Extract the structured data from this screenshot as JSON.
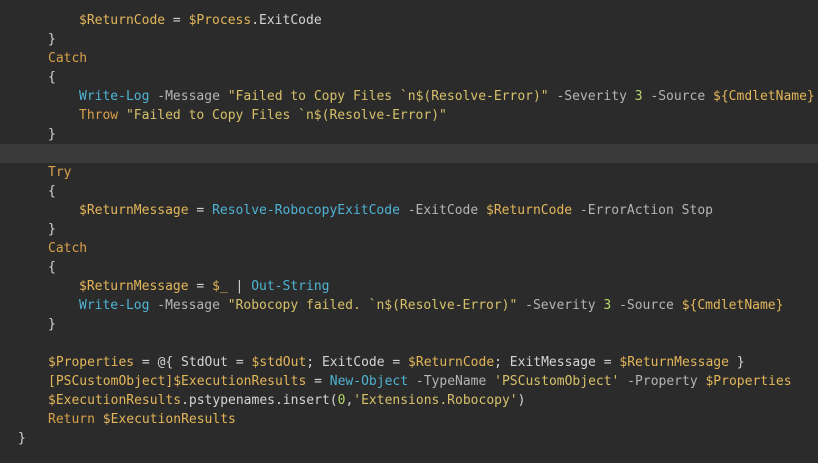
{
  "colors": {
    "background": "#2b2b2b",
    "current_line": "#3a3a3a",
    "default": "#d4d4d4",
    "keyword": "#d8a24a",
    "variable": "#e3b65a",
    "cmdlet": "#4fb3d4",
    "param": "#b4b4b4",
    "string": "#d6c06a",
    "punct": "#d4d4d4",
    "number": "#b7d86b"
  },
  "lines": [
    {
      "indent": 8,
      "tokens": [
        {
          "t": "$ReturnCode",
          "c": "variable"
        },
        {
          "t": " = ",
          "c": "punct"
        },
        {
          "t": "$Process",
          "c": "variable"
        },
        {
          "t": ".ExitCode",
          "c": "default"
        }
      ]
    },
    {
      "indent": 4,
      "tokens": [
        {
          "t": "}",
          "c": "punct"
        }
      ]
    },
    {
      "indent": 4,
      "tokens": [
        {
          "t": "Catch",
          "c": "keyword"
        }
      ]
    },
    {
      "indent": 4,
      "tokens": [
        {
          "t": "{",
          "c": "punct"
        }
      ]
    },
    {
      "indent": 8,
      "tokens": [
        {
          "t": "Write-Log",
          "c": "cmdlet"
        },
        {
          "t": " -Message ",
          "c": "param"
        },
        {
          "t": "\"Failed to Copy Files `n$(Resolve-Error)\"",
          "c": "string"
        },
        {
          "t": " -Severity ",
          "c": "param"
        },
        {
          "t": "3",
          "c": "number"
        },
        {
          "t": " -Source ",
          "c": "param"
        },
        {
          "t": "${CmdletName}",
          "c": "variable"
        }
      ]
    },
    {
      "indent": 8,
      "tokens": [
        {
          "t": "Throw",
          "c": "keyword"
        },
        {
          "t": " ",
          "c": "default"
        },
        {
          "t": "\"Failed to Copy Files `n$(Resolve-Error)\"",
          "c": "string"
        }
      ]
    },
    {
      "indent": 4,
      "tokens": [
        {
          "t": "}",
          "c": "punct"
        }
      ]
    },
    {
      "indent": 0,
      "current": true,
      "tokens": []
    },
    {
      "indent": 4,
      "tokens": [
        {
          "t": "Try",
          "c": "keyword"
        }
      ]
    },
    {
      "indent": 4,
      "tokens": [
        {
          "t": "{",
          "c": "punct"
        }
      ]
    },
    {
      "indent": 8,
      "tokens": [
        {
          "t": "$ReturnMessage",
          "c": "variable"
        },
        {
          "t": " = ",
          "c": "punct"
        },
        {
          "t": "Resolve-RobocopyExitCode",
          "c": "cmdlet"
        },
        {
          "t": " -ExitCode ",
          "c": "param"
        },
        {
          "t": "$ReturnCode",
          "c": "variable"
        },
        {
          "t": " -ErrorAction Stop",
          "c": "param"
        }
      ]
    },
    {
      "indent": 4,
      "tokens": [
        {
          "t": "}",
          "c": "punct"
        }
      ]
    },
    {
      "indent": 4,
      "tokens": [
        {
          "t": "Catch",
          "c": "keyword"
        }
      ]
    },
    {
      "indent": 4,
      "tokens": [
        {
          "t": "{",
          "c": "punct"
        }
      ]
    },
    {
      "indent": 8,
      "tokens": [
        {
          "t": "$ReturnMessage",
          "c": "variable"
        },
        {
          "t": " = ",
          "c": "punct"
        },
        {
          "t": "$_",
          "c": "variable"
        },
        {
          "t": " | ",
          "c": "punct"
        },
        {
          "t": "Out-String",
          "c": "cmdlet"
        }
      ]
    },
    {
      "indent": 8,
      "tokens": [
        {
          "t": "Write-Log",
          "c": "cmdlet"
        },
        {
          "t": " -Message ",
          "c": "param"
        },
        {
          "t": "\"Robocopy failed. `n$(Resolve-Error)\"",
          "c": "string"
        },
        {
          "t": " -Severity ",
          "c": "param"
        },
        {
          "t": "3",
          "c": "number"
        },
        {
          "t": " -Source ",
          "c": "param"
        },
        {
          "t": "${CmdletName}",
          "c": "variable"
        }
      ]
    },
    {
      "indent": 4,
      "tokens": [
        {
          "t": "}",
          "c": "punct"
        }
      ]
    },
    {
      "indent": 0,
      "tokens": []
    },
    {
      "indent": 4,
      "tokens": [
        {
          "t": "$Properties",
          "c": "variable"
        },
        {
          "t": " = @{ StdOut = ",
          "c": "punct"
        },
        {
          "t": "$stdOut",
          "c": "variable"
        },
        {
          "t": "; ExitCode = ",
          "c": "punct"
        },
        {
          "t": "$ReturnCode",
          "c": "variable"
        },
        {
          "t": "; ExitMessage = ",
          "c": "punct"
        },
        {
          "t": "$ReturnMessage",
          "c": "variable"
        },
        {
          "t": " }",
          "c": "punct"
        }
      ]
    },
    {
      "indent": 4,
      "tokens": [
        {
          "t": "[PSCustomObject]",
          "c": "variable"
        },
        {
          "t": "$ExecutionResults",
          "c": "variable"
        },
        {
          "t": " = ",
          "c": "punct"
        },
        {
          "t": "New-Object",
          "c": "cmdlet"
        },
        {
          "t": " -TypeName ",
          "c": "param"
        },
        {
          "t": "'PSCustomObject'",
          "c": "string"
        },
        {
          "t": " -Property ",
          "c": "param"
        },
        {
          "t": "$Properties",
          "c": "variable"
        }
      ]
    },
    {
      "indent": 4,
      "tokens": [
        {
          "t": "$ExecutionResults",
          "c": "variable"
        },
        {
          "t": ".pstypenames.insert(",
          "c": "default"
        },
        {
          "t": "0",
          "c": "number"
        },
        {
          "t": ",",
          "c": "punct"
        },
        {
          "t": "'Extensions.Robocopy'",
          "c": "string"
        },
        {
          "t": ")",
          "c": "punct"
        }
      ]
    },
    {
      "indent": 4,
      "tokens": [
        {
          "t": "Return",
          "c": "keyword"
        },
        {
          "t": " ",
          "c": "default"
        },
        {
          "t": "$ExecutionResults",
          "c": "variable"
        }
      ]
    },
    {
      "indent": 2,
      "tokens": [
        {
          "t": "}",
          "c": "punct"
        }
      ]
    }
  ]
}
